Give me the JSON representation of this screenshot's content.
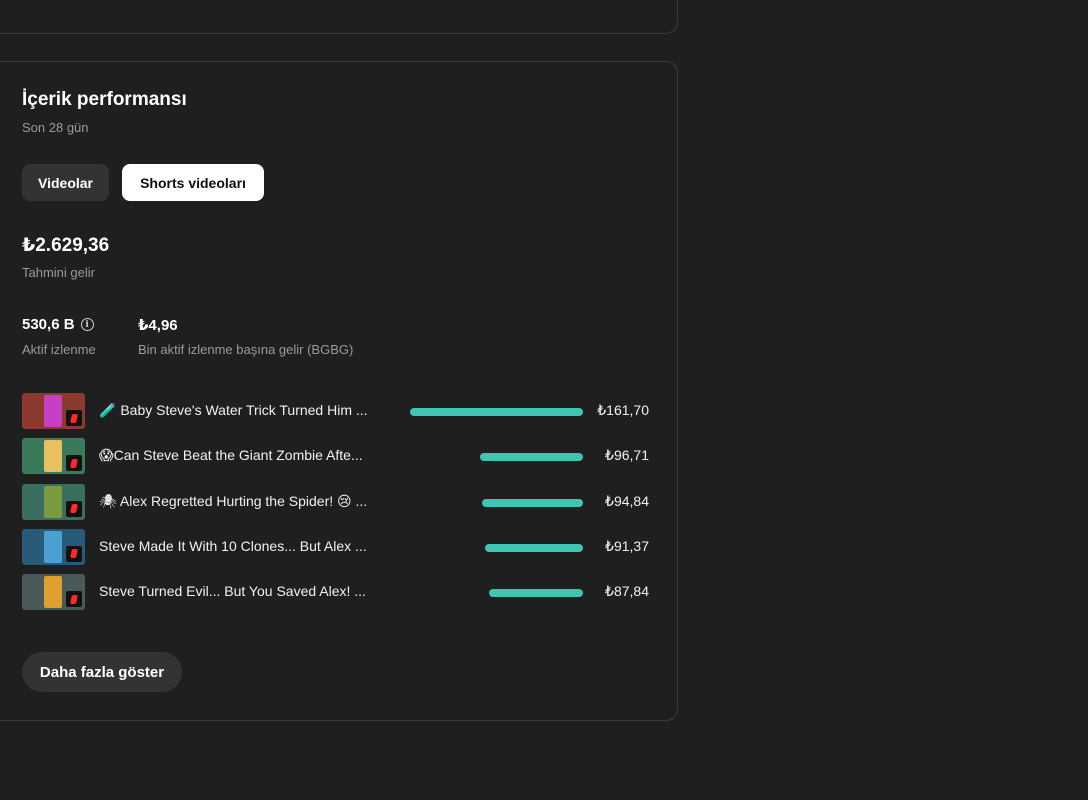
{
  "card": {
    "title": "İçerik performansı",
    "subtitle": "Son 28 gün"
  },
  "tabs": [
    {
      "label": "Videolar",
      "selected": false
    },
    {
      "label": "Shorts videoları",
      "selected": true
    }
  ],
  "revenue": {
    "value": "₺2.629,36",
    "label": "Tahmini gelir"
  },
  "metrics": [
    {
      "value": "530,6 B",
      "label": "Aktif izlenme",
      "icon": "info-icon"
    },
    {
      "value": "₺4,96",
      "label": "Bin aktif izlenme başına gelir (BGBG)"
    }
  ],
  "videos": [
    {
      "title": "🧪 Baby Steve's Water Trick Turned Him ...",
      "value": "₺161,70",
      "amount": 161.7,
      "thumb_color": "#8a3a2e",
      "figure_color": "#c640c6"
    },
    {
      "title": "😱Can Steve Beat the Giant Zombie Afte...",
      "value": "₺96,71",
      "amount": 96.71,
      "thumb_color": "#3a7a5a",
      "figure_color": "#e8c060"
    },
    {
      "title": "🕷 Alex Regretted Hurting the Spider! 😢 ...",
      "value": "₺94,84",
      "amount": 94.84,
      "thumb_color": "#3a6e5e",
      "figure_color": "#7a9a40"
    },
    {
      "title": "Steve Made It With 10 Clones... But Alex ...",
      "value": "₺91,37",
      "amount": 91.37,
      "thumb_color": "#2a5a7a",
      "figure_color": "#4aa0d0"
    },
    {
      "title": "Steve Turned Evil... But You Saved Alex! ...",
      "value": "₺87,84",
      "amount": 87.84,
      "thumb_color": "#4a5a5a",
      "figure_color": "#e0a030"
    }
  ],
  "show_more_label": "Daha fazla göster",
  "colors": {
    "background": "#1f1f1f",
    "bar": "#3fc6b3",
    "muted_text": "#9a9a9a"
  }
}
